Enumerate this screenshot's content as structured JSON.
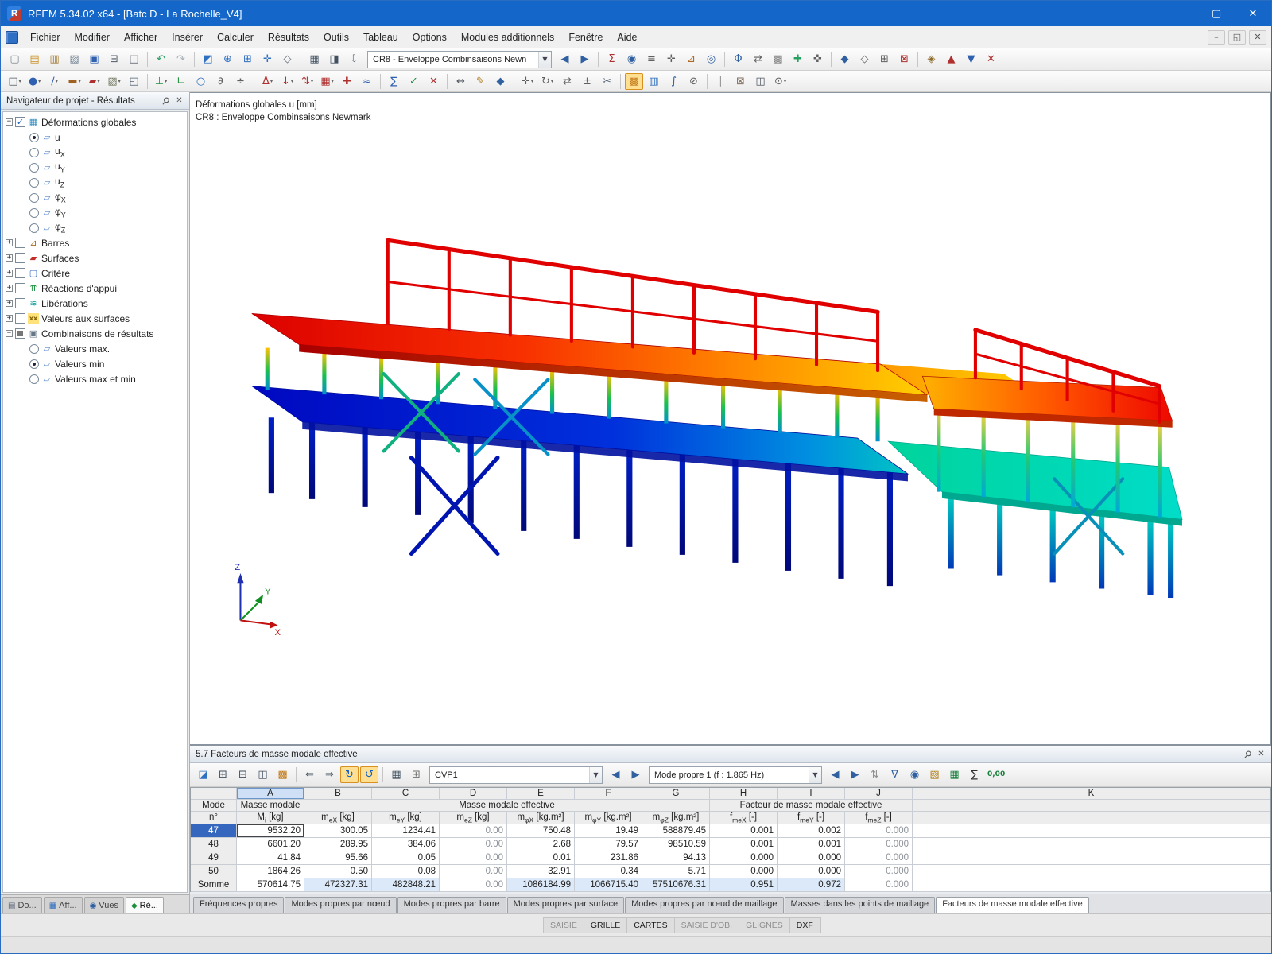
{
  "colors": {
    "titlebar": "#1467c8",
    "selection": "#3567be",
    "deformation_max": "#dc0000",
    "deformation_min": "#0008c0"
  },
  "titlebar": {
    "app_title": "RFEM 5.34.02 x64 - [Batc D - La Rochelle_V4]",
    "minimize": "–",
    "maximize": "▢",
    "close": "✕"
  },
  "menu": {
    "items": [
      "Fichier",
      "Modifier",
      "Afficher",
      "Insérer",
      "Calculer",
      "Résultats",
      "Outils",
      "Tableau",
      "Options",
      "Modules additionnels",
      "Fenêtre",
      "Aide"
    ],
    "mdi_minimize": "–",
    "mdi_restore": "◱",
    "mdi_close": "✕"
  },
  "toolbar1": {
    "combo_value": "CR8 - Enveloppe Combinsaisons Newn",
    "icons_left": [
      {
        "n": "new-model",
        "g": "▢",
        "c": "#808890"
      },
      {
        "n": "open-model",
        "g": "▤",
        "c": "#c89020"
      },
      {
        "n": "open-project-manager",
        "g": "▥",
        "c": "#a07830"
      },
      {
        "n": "archive-model",
        "g": "▨",
        "c": "#708090"
      },
      {
        "n": "save-model",
        "g": "▣",
        "c": "#3060b0"
      },
      {
        "n": "print-graphic",
        "g": "⊟",
        "c": "#505868"
      },
      {
        "n": "print-preview",
        "g": "◫",
        "c": "#505868"
      },
      {
        "sep": true
      },
      {
        "n": "undo",
        "g": "↶",
        "c": "#28a060"
      },
      {
        "n": "redo",
        "g": "↷",
        "c": "#a8b0b8"
      },
      {
        "sep": true
      },
      {
        "n": "render-model",
        "g": "◩",
        "c": "#3070c0"
      },
      {
        "n": "zoom-in",
        "g": "⊕",
        "c": "#3070c0"
      },
      {
        "n": "zoom-window",
        "g": "⊞",
        "c": "#3070c0"
      },
      {
        "n": "pan-view",
        "g": "✛",
        "c": "#3070c0"
      },
      {
        "n": "isometric-view",
        "g": "◇",
        "c": "#606870"
      },
      {
        "sep": true
      },
      {
        "n": "show-tables",
        "g": "▦",
        "c": "#405060"
      },
      {
        "n": "show-panel",
        "g": "◨",
        "c": "#405060"
      },
      {
        "n": "load-case-list",
        "g": "⇩",
        "c": "#506070"
      }
    ],
    "icons_right": [
      {
        "n": "previous-load-case",
        "g": "◀",
        "c": "#3060a0"
      },
      {
        "n": "next-load-case",
        "g": "▶",
        "c": "#3060a0"
      },
      {
        "sep": true
      },
      {
        "n": "show-results",
        "g": "Σ",
        "c": "#b03030"
      },
      {
        "n": "result-values",
        "g": "◉",
        "c": "#3060a0"
      },
      {
        "n": "display-navigator",
        "g": "≡",
        "c": "#606060"
      },
      {
        "n": "selection-pointer",
        "g": "✛",
        "c": "#606060"
      },
      {
        "n": "show-numbering",
        "g": "⊿",
        "c": "#b06820"
      },
      {
        "n": "visibility-mode",
        "g": "◎",
        "c": "#3060a0"
      },
      {
        "sep": true
      },
      {
        "n": "section-view",
        "g": "Φ",
        "c": "#3060a0"
      },
      {
        "n": "compare-results",
        "g": "⇄",
        "c": "#606060"
      },
      {
        "n": "display-grid",
        "g": "▩",
        "c": "#808080"
      },
      {
        "n": "add-comment",
        "g": "✚",
        "c": "#28a060"
      },
      {
        "n": "center-view",
        "g": "✜",
        "c": "#606060"
      },
      {
        "sep": true
      },
      {
        "n": "render-solid",
        "g": "◆",
        "c": "#3060a0"
      },
      {
        "n": "render-wireframe",
        "g": "◇",
        "c": "#606060"
      },
      {
        "n": "new-window",
        "g": "⊞",
        "c": "#606060"
      },
      {
        "n": "close-window",
        "g": "⊠",
        "c": "#b03030"
      },
      {
        "sep": true
      },
      {
        "n": "block-manager",
        "g": "◈",
        "c": "#907030"
      },
      {
        "n": "printout-report",
        "g": "▲",
        "c": "#b03030"
      },
      {
        "n": "export-ifc",
        "g": "▼",
        "c": "#3060b0"
      },
      {
        "n": "delete-results",
        "g": "✕",
        "c": "#b03030"
      }
    ]
  },
  "toolbar2": {
    "icons": [
      {
        "n": "select-special",
        "g": "□",
        "c": "#505860",
        "caret": true
      },
      {
        "n": "insert-node",
        "g": "●",
        "c": "#3060b0",
        "caret": true
      },
      {
        "n": "insert-line",
        "g": "∕",
        "c": "#3060b0",
        "caret": true
      },
      {
        "n": "insert-member",
        "g": "▬",
        "c": "#a06020",
        "caret": true
      },
      {
        "n": "insert-surface",
        "g": "▰",
        "c": "#b03030",
        "caret": true
      },
      {
        "n": "insert-solid",
        "g": "▧",
        "c": "#707860",
        "caret": true
      },
      {
        "n": "insert-opening",
        "g": "◰",
        "c": "#506070"
      },
      {
        "sep": true
      },
      {
        "n": "nodal-support",
        "g": "⊥",
        "c": "#209040",
        "caret": true
      },
      {
        "n": "line-support",
        "g": "∟",
        "c": "#209040"
      },
      {
        "n": "member-hinge",
        "g": "○",
        "c": "#3070c0"
      },
      {
        "n": "member-eccentricity",
        "g": "∂",
        "c": "#606060"
      },
      {
        "n": "divide-member",
        "g": "÷",
        "c": "#606060"
      },
      {
        "sep": true
      },
      {
        "n": "load-case",
        "g": "Δ",
        "c": "#b03030",
        "caret": true
      },
      {
        "n": "nodal-load",
        "g": "↓",
        "c": "#b03030",
        "caret": true
      },
      {
        "n": "member-load",
        "g": "⇅",
        "c": "#b03030",
        "caret": true
      },
      {
        "n": "surface-load",
        "g": "▦",
        "c": "#b03030",
        "caret": true
      },
      {
        "n": "free-load",
        "g": "✚",
        "c": "#b03030"
      },
      {
        "n": "imperfection",
        "g": "≈",
        "c": "#3060b0"
      },
      {
        "sep": true
      },
      {
        "n": "calculate-all",
        "g": "∑",
        "c": "#3060b0"
      },
      {
        "n": "check-model",
        "g": "✓",
        "c": "#209040"
      },
      {
        "n": "stop-calculation",
        "g": "✕",
        "c": "#b03030"
      },
      {
        "sep": true
      },
      {
        "n": "dimension-line",
        "g": "↔",
        "c": "#505860"
      },
      {
        "n": "text-comment",
        "g": "✎",
        "c": "#b08020"
      },
      {
        "n": "visual-object",
        "g": "◆",
        "c": "#3060a0"
      },
      {
        "sep": true
      },
      {
        "n": "move-copy",
        "g": "✛",
        "c": "#606060",
        "caret": true
      },
      {
        "n": "rotate-object",
        "g": "↻",
        "c": "#606060",
        "caret": true
      },
      {
        "n": "mirror-object",
        "g": "⇄",
        "c": "#606060"
      },
      {
        "n": "scale-object",
        "g": "±",
        "c": "#606060"
      },
      {
        "n": "trim-lines",
        "g": "✂",
        "c": "#506070"
      },
      {
        "sep": true
      },
      {
        "n": "control-panel",
        "g": "▩",
        "c": "#c07818",
        "active": true
      },
      {
        "n": "color-scale",
        "g": "▥",
        "c": "#3070c0"
      },
      {
        "n": "result-diagram",
        "g": "∫",
        "c": "#3060a0"
      },
      {
        "n": "clipping-plane",
        "g": "⊘",
        "c": "#606060"
      },
      {
        "sep": true
      },
      {
        "n": "guide-lines",
        "g": "∣",
        "c": "#909090"
      },
      {
        "n": "dxf-underlay",
        "g": "⊠",
        "c": "#807060"
      },
      {
        "n": "print-report",
        "g": "◫",
        "c": "#505860"
      },
      {
        "n": "program-options",
        "g": "⊙",
        "c": "#606060",
        "caret": true
      }
    ]
  },
  "navigator": {
    "title": "Navigateur de projet - Résultats",
    "tree": [
      {
        "label": "Déformations globales",
        "expanded": true,
        "checked": true,
        "icon": {
          "g": "▦",
          "c": "#2e8bc0"
        },
        "children": [
          {
            "label": "u",
            "base": "u",
            "sub": "",
            "selected": true,
            "icon": {
              "g": "▱",
              "c": "#5b8bd0"
            }
          },
          {
            "label": "uX",
            "base": "u",
            "sub": "X",
            "icon": {
              "g": "▱",
              "c": "#5b8bd0"
            }
          },
          {
            "label": "uY",
            "base": "u",
            "sub": "Y",
            "icon": {
              "g": "▱",
              "c": "#5b8bd0"
            }
          },
          {
            "label": "uZ",
            "base": "u",
            "sub": "Z",
            "icon": {
              "g": "▱",
              "c": "#5b8bd0"
            }
          },
          {
            "label": "φX",
            "base": "φ",
            "sub": "X",
            "icon": {
              "g": "▱",
              "c": "#5b8bd0"
            }
          },
          {
            "label": "φY",
            "base": "φ",
            "sub": "Y",
            "icon": {
              "g": "▱",
              "c": "#5b8bd0"
            }
          },
          {
            "label": "φZ",
            "base": "φ",
            "sub": "Z",
            "icon": {
              "g": "▱",
              "c": "#5b8bd0"
            }
          }
        ]
      },
      {
        "label": "Barres",
        "icon": {
          "g": "⊿",
          "c": "#b06820"
        }
      },
      {
        "label": "Surfaces",
        "icon": {
          "g": "▰",
          "c": "#c03028"
        }
      },
      {
        "label": "Critère",
        "icon": {
          "g": "▢",
          "c": "#3a6cc0"
        }
      },
      {
        "label": "Réactions d'appui",
        "icon": {
          "g": "⇈",
          "c": "#1a8f3c"
        }
      },
      {
        "label": "Libérations",
        "icon": {
          "g": "≋",
          "c": "#18a0a0"
        }
      },
      {
        "label": "Valeurs aux surfaces",
        "icon": {
          "g": "xx",
          "c": "#806000",
          "bg": "#ffe27a"
        }
      },
      {
        "label": "Combinaisons de résultats",
        "expanded": true,
        "tristate": true,
        "icon": {
          "g": "▣",
          "c": "#667788"
        },
        "children": [
          {
            "label": "Valeurs max.",
            "icon": {
              "g": "▱",
              "c": "#5b8bd0"
            }
          },
          {
            "label": "Valeurs min",
            "selected": true,
            "icon": {
              "g": "▱",
              "c": "#5b8bd0"
            }
          },
          {
            "label": "Valeurs max et min",
            "icon": {
              "g": "▱",
              "c": "#5b8bd0"
            }
          }
        ]
      }
    ],
    "tabs": [
      {
        "label": "Do...",
        "icon": {
          "g": "▤",
          "c": "#606878"
        }
      },
      {
        "label": "Aff...",
        "icon": {
          "g": "▦",
          "c": "#3070c0"
        }
      },
      {
        "label": "Vues",
        "icon": {
          "g": "◉",
          "c": "#3060a0"
        }
      },
      {
        "label": "Ré...",
        "icon": {
          "g": "◆",
          "c": "#1a8f3c"
        },
        "active": true
      }
    ]
  },
  "viewport": {
    "caption1": "Déformations globales u [mm]",
    "caption2": "CR8 : Enveloppe Combinsaisons Newmark",
    "axis_x": "X",
    "axis_y": "Y",
    "axis_z": "Z"
  },
  "table_panel": {
    "title": "5.7 Facteurs de masse modale effective",
    "toolbar": {
      "icons_left": [
        {
          "n": "table-settings",
          "g": "◪",
          "c": "#3070c0"
        },
        {
          "n": "insert-column",
          "g": "⊞",
          "c": "#405060"
        },
        {
          "n": "delete-row",
          "g": "⊟",
          "c": "#405060"
        },
        {
          "n": "split-view",
          "g": "◫",
          "c": "#405060"
        },
        {
          "n": "color-rows",
          "g": "▩",
          "c": "#c07818"
        },
        {
          "sep": true
        },
        {
          "n": "import-table",
          "g": "⇐",
          "c": "#405060"
        },
        {
          "n": "export-table",
          "g": "⇒",
          "c": "#405060"
        },
        {
          "n": "sync-selection",
          "g": "↻",
          "c": "#1060c0",
          "active": true
        },
        {
          "n": "sync-view",
          "g": "↺",
          "c": "#1060c0",
          "active": true
        },
        {
          "sep": true
        },
        {
          "n": "result-filter",
          "g": "▦",
          "c": "#405060"
        },
        {
          "n": "table-calculator",
          "g": "⊞",
          "c": "#707070"
        }
      ],
      "combo1": "CVP1",
      "nav1": [
        {
          "n": "previous-case",
          "g": "◀",
          "c": "#3060a0"
        },
        {
          "n": "next-case",
          "g": "▶",
          "c": "#3060a0"
        }
      ],
      "combo2": "Mode propre 1 (f : 1.865 Hz)",
      "nav2": [
        {
          "n": "previous-mode",
          "g": "◀",
          "c": "#3060a0"
        },
        {
          "n": "next-mode",
          "g": "▶",
          "c": "#3060a0"
        }
      ],
      "icons_right": [
        {
          "n": "jump-to-row",
          "g": "⇅",
          "c": "#909090"
        },
        {
          "n": "filter-rows",
          "g": "∇",
          "c": "#3060a0"
        },
        {
          "n": "find-in-table",
          "g": "◉",
          "c": "#3060a0"
        },
        {
          "n": "highlight-exceeded",
          "g": "▧",
          "c": "#b08020"
        },
        {
          "n": "export-excel",
          "g": "▦",
          "c": "#1a7f3c"
        },
        {
          "n": "show-sums",
          "g": "∑",
          "c": "#303030"
        },
        {
          "n": "decimal-places",
          "g": "0,00",
          "c": "#1a7f3c",
          "wide": true
        }
      ]
    },
    "letters": [
      "A",
      "B",
      "C",
      "D",
      "E",
      "F",
      "G",
      "H",
      "I",
      "J",
      "K"
    ],
    "header": {
      "mode_top": "Mode",
      "mode_bottom": "n°",
      "col_a_top": "Masse modale",
      "group_mme": "Masse modale effective",
      "group_fmme": "Facteur de masse modale effective",
      "cols": [
        {
          "b": "M",
          "s": "i",
          "u": "[kg]"
        },
        {
          "b": "m",
          "s": "eX",
          "u": "[kg]"
        },
        {
          "b": "m",
          "s": "eY",
          "u": "[kg]"
        },
        {
          "b": "m",
          "s": "eZ",
          "u": "[kg]"
        },
        {
          "b": "m",
          "s": "φX",
          "u": "[kg.m²]"
        },
        {
          "b": "m",
          "s": "φY",
          "u": "[kg.m²]"
        },
        {
          "b": "m",
          "s": "φZ",
          "u": "[kg.m²]"
        },
        {
          "b": "f",
          "s": "meX",
          "u": "[-]"
        },
        {
          "b": "f",
          "s": "meY",
          "u": "[-]"
        },
        {
          "b": "f",
          "s": "meZ",
          "u": "[-]"
        }
      ]
    },
    "rows": [
      {
        "mode": "47",
        "selected": true,
        "cells": [
          "9532.20",
          "300.05",
          "1234.41",
          "0.00",
          "750.48",
          "19.49",
          "588879.45",
          "0.001",
          "0.002",
          "0.000"
        ]
      },
      {
        "mode": "48",
        "cells": [
          "6601.20",
          "289.95",
          "384.06",
          "0.00",
          "2.68",
          "79.57",
          "98510.59",
          "0.001",
          "0.001",
          "0.000"
        ]
      },
      {
        "mode": "49",
        "cells": [
          "41.84",
          "95.66",
          "0.05",
          "0.00",
          "0.01",
          "231.86",
          "94.13",
          "0.000",
          "0.000",
          "0.000"
        ]
      },
      {
        "mode": "50",
        "cells": [
          "1864.26",
          "0.50",
          "0.08",
          "0.00",
          "32.91",
          "0.34",
          "5.71",
          "0.000",
          "0.000",
          "0.000"
        ]
      }
    ],
    "sum_row": {
      "mode": "Somme",
      "cells": [
        "570614.75",
        "472327.31",
        "482848.21",
        "0.00",
        "1086184.99",
        "1066715.40",
        "57510676.31",
        "0.951",
        "0.972",
        "0.000"
      ],
      "highlighted": [
        1,
        2,
        4,
        5,
        6,
        7,
        8
      ]
    },
    "tabs": [
      "Fréquences propres",
      "Modes propres par nœud",
      "Modes propres par barre",
      "Modes propres par surface",
      "Modes propres par nœud de maillage",
      "Masses dans les points de maillage",
      "Facteurs de masse modale effective"
    ],
    "active_tab": "Facteurs de masse modale effective"
  },
  "statusbar": {
    "toggles": [
      {
        "label": "SAISIE",
        "active": false
      },
      {
        "label": "GRILLE",
        "active": true
      },
      {
        "label": "CARTES",
        "active": true
      },
      {
        "label": "SAISIE D'OB.",
        "active": false
      },
      {
        "label": "GLIGNES",
        "active": false
      },
      {
        "label": "DXF",
        "active": true
      }
    ]
  }
}
